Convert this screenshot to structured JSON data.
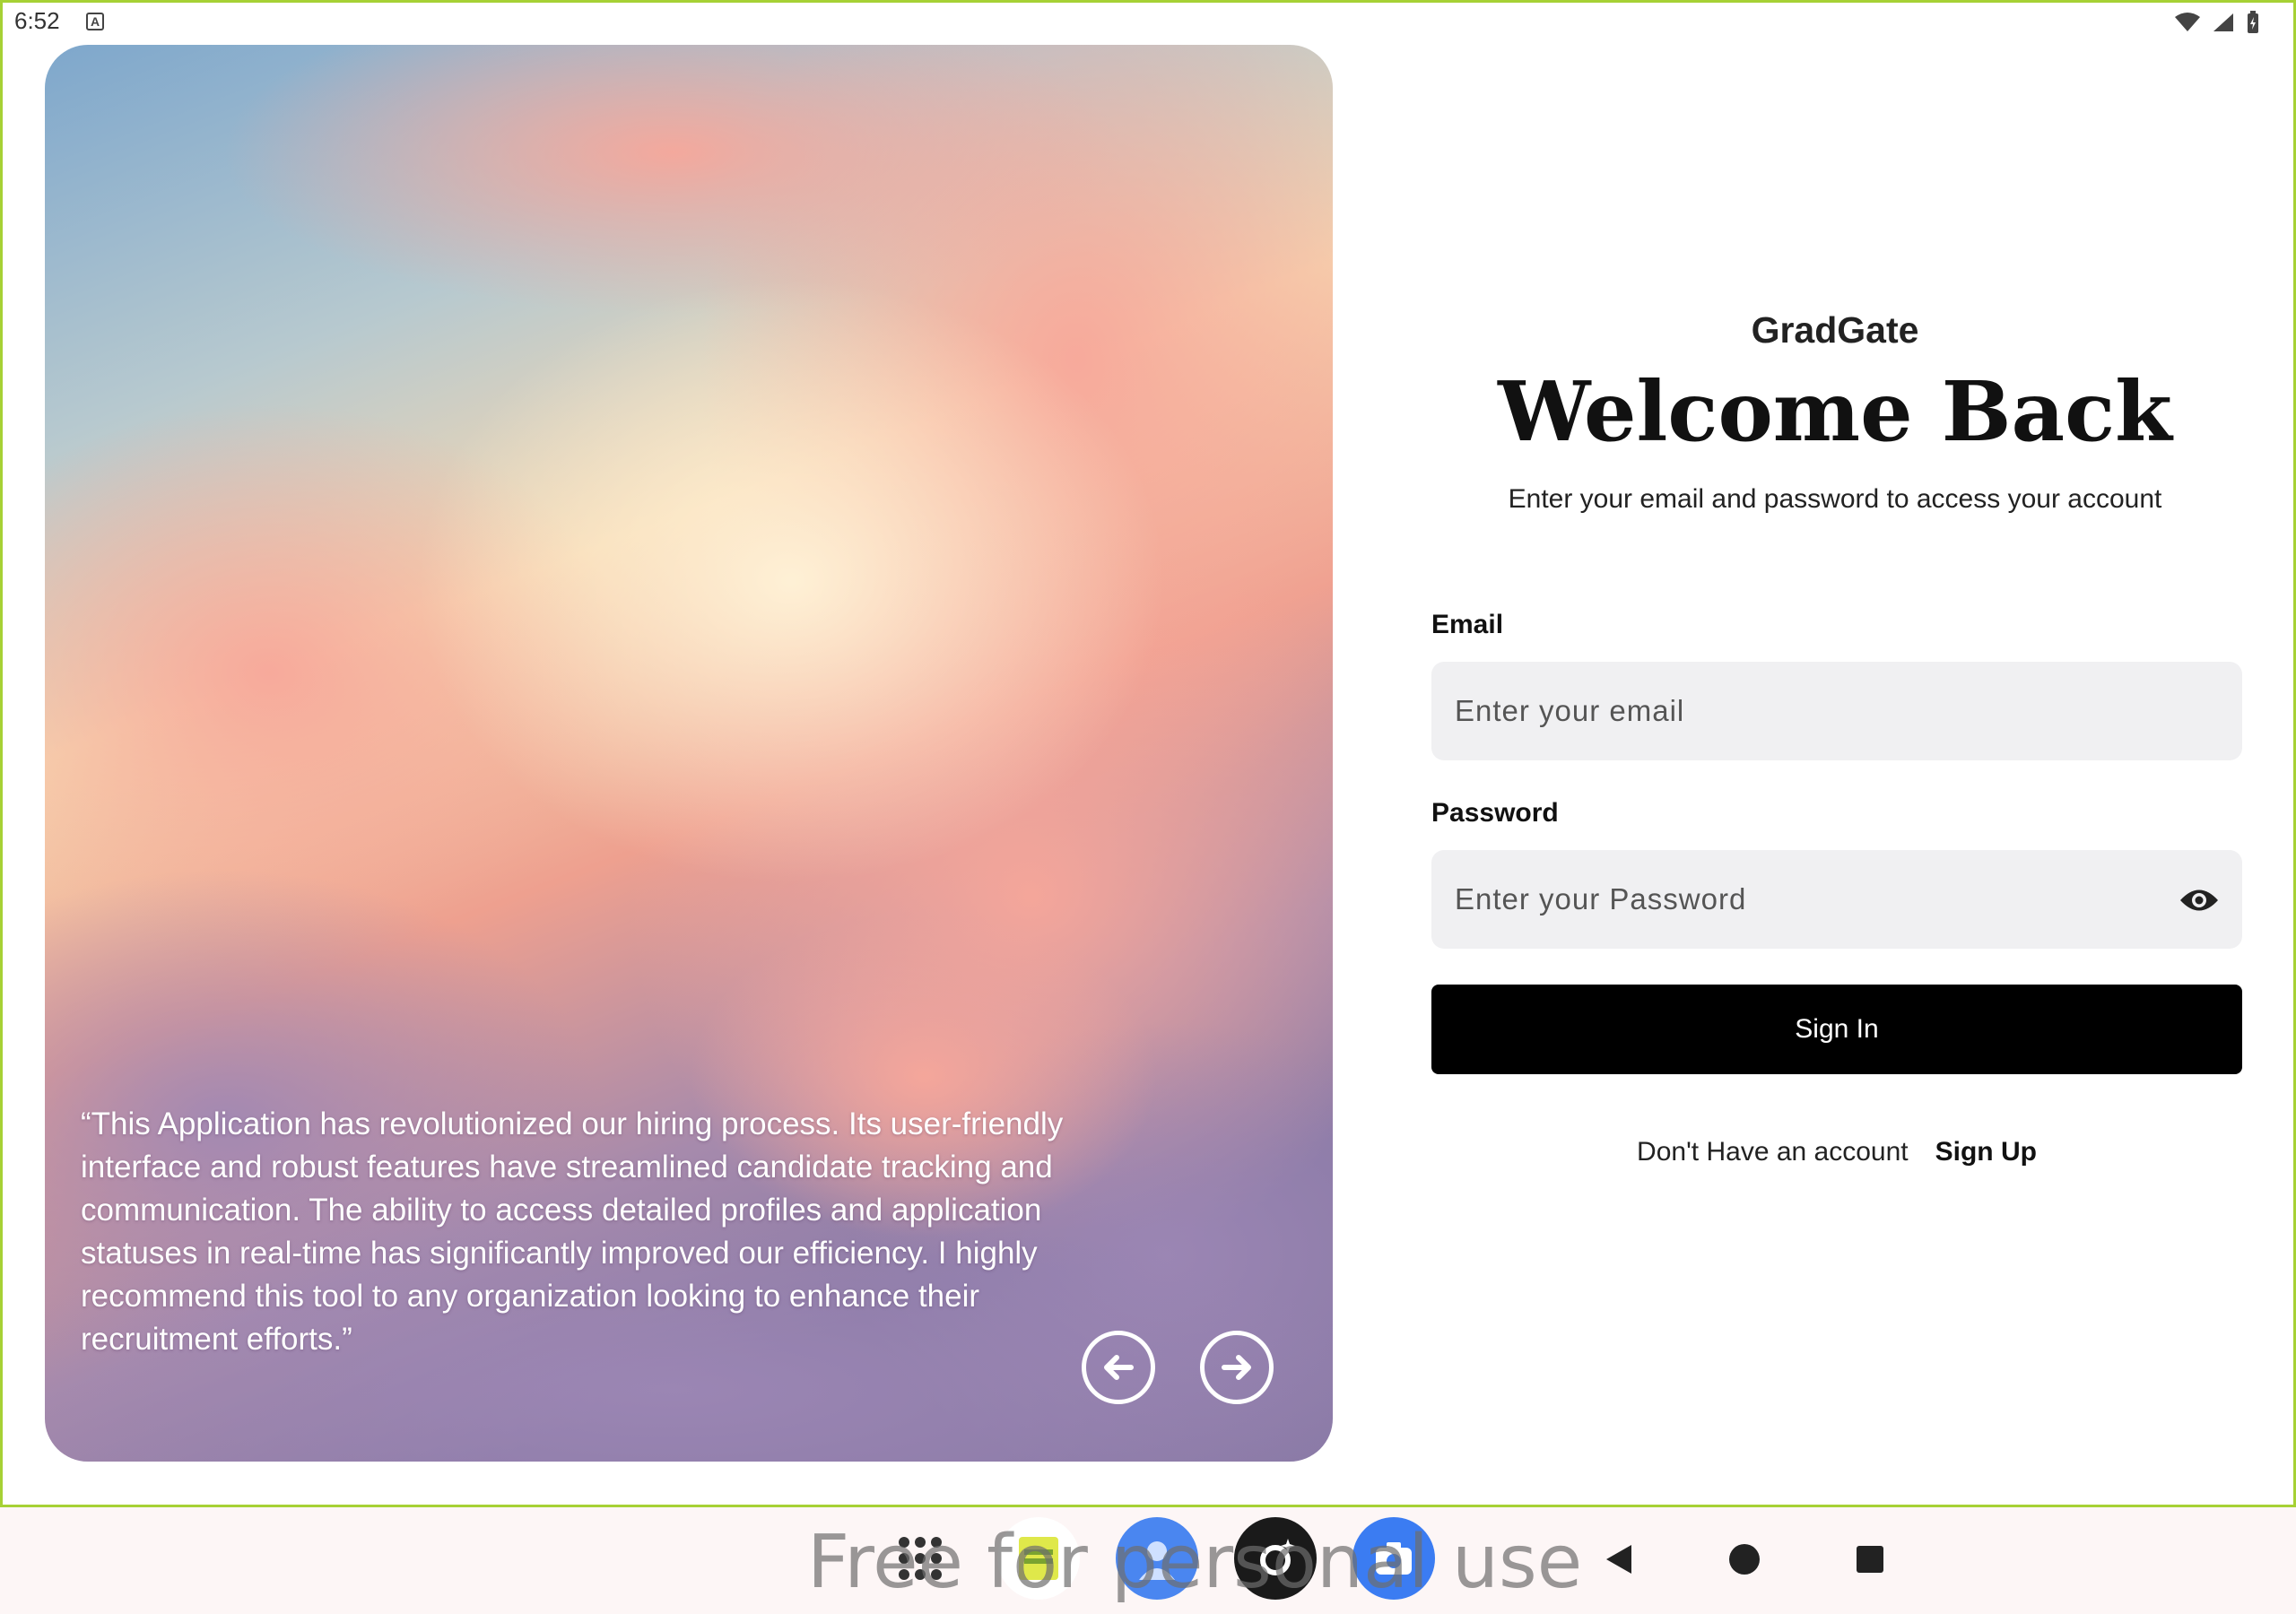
{
  "status_bar": {
    "time": "6:52",
    "indicator": "A",
    "icons": [
      "wifi-icon",
      "signal-icon",
      "battery-icon"
    ]
  },
  "hero": {
    "quote": "“This Application has revolutionized our hiring process. Its user-friendly interface and robust features have streamlined candidate tracking and communication. The ability to access detailed profiles and application statuses in real-time has significantly improved our efficiency. I highly recommend this tool to any organization looking to enhance their recruitment efforts.”",
    "prev_icon": "arrow-left-icon",
    "next_icon": "arrow-right-icon"
  },
  "login": {
    "brand": "GradGate",
    "title": "Welcome Back",
    "subtitle": "Enter your email and password to access your account",
    "email_label": "Email",
    "email_placeholder": "Enter your email",
    "email_value": "",
    "password_label": "Password",
    "password_placeholder": "Enter your Password",
    "password_value": "",
    "password_toggle_icon": "eye-icon",
    "signin_label": "Sign In",
    "signup_prompt": "Don't Have an account",
    "signup_link": "Sign Up"
  },
  "dock": {
    "apps": [
      "app-drawer-icon",
      "sheets-app-icon",
      "contacts-app-icon",
      "ai-assistant-app-icon",
      "camera-app-icon"
    ],
    "nav": [
      "back-icon",
      "home-icon",
      "recents-icon"
    ]
  },
  "watermark": "Free for personal use",
  "colors": {
    "frame_border": "#a6d135",
    "button_bg": "#000000",
    "input_bg": "#f0f0f2",
    "nav_bar_bg": "#fdf6f6"
  }
}
